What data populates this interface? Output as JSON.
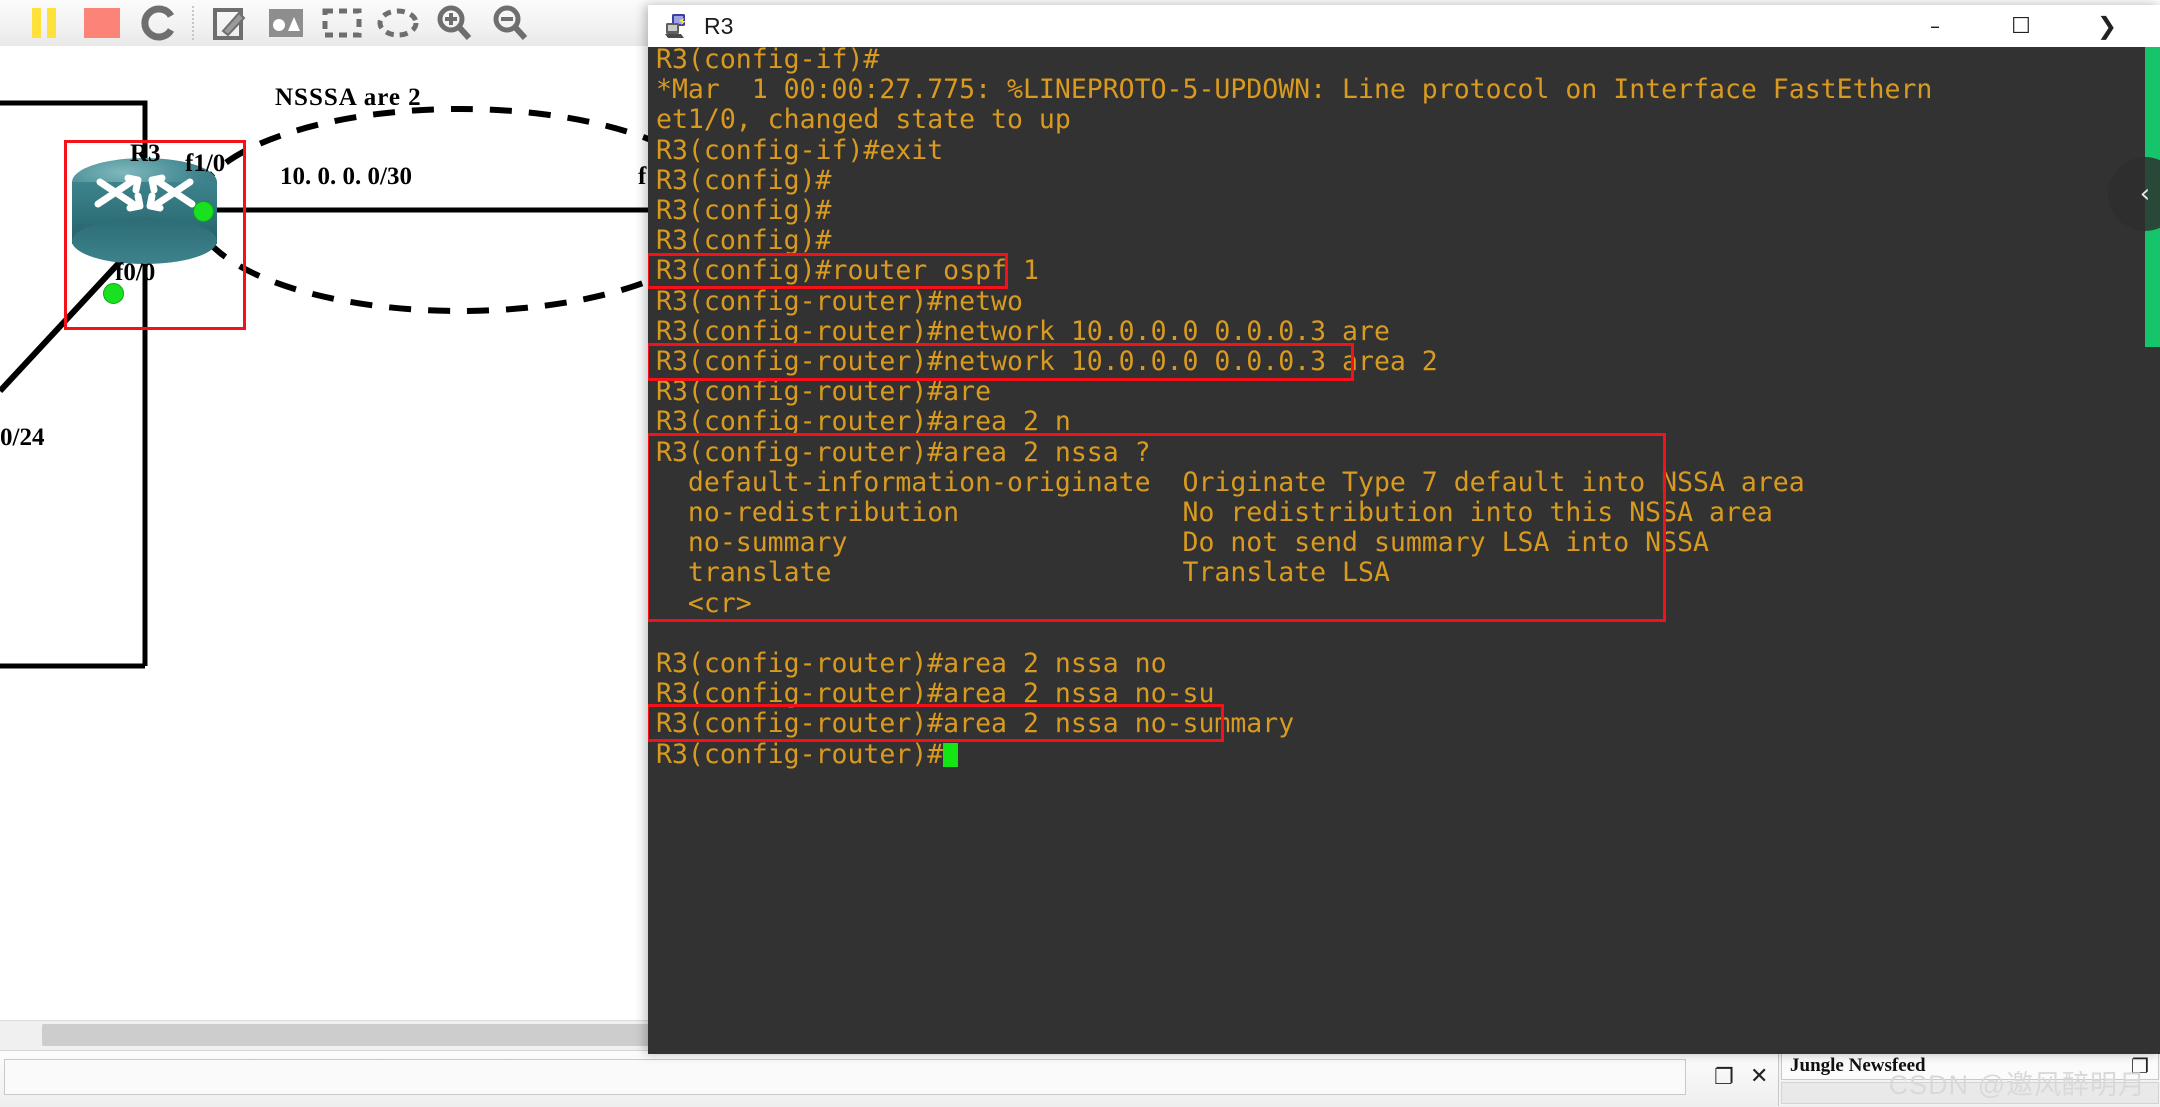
{
  "toolbar": {
    "items": [
      {
        "name": "pause-icon",
        "glyph": "❚❚"
      },
      {
        "name": "stop-icon",
        "glyph": "■"
      },
      {
        "name": "reload-icon",
        "glyph": "C"
      },
      {
        "name": "add-note-icon",
        "glyph": "✎"
      },
      {
        "name": "insert-picture-icon",
        "glyph": "▲"
      },
      {
        "name": "draw-rectangle-icon",
        "glyph": "▭"
      },
      {
        "name": "draw-ellipse-icon",
        "glyph": "◯"
      },
      {
        "name": "zoom-in-icon",
        "glyph": "⊕"
      },
      {
        "name": "zoom-out-icon",
        "glyph": "⊖"
      }
    ]
  },
  "topology": {
    "area_label": "NSSSA  are 2",
    "link_subnet": "10. 0. 0. 0/30",
    "router_name": "R3",
    "iface_top": "f1/0",
    "iface_bottom": "f0/0",
    "left_subnet_partial": "0/24",
    "right_iface_partial": "f"
  },
  "window": {
    "title": "R3",
    "icon": "console-terminal-icon",
    "minimize": "–",
    "maximize": "☐",
    "close": "❯"
  },
  "overlay": {
    "back_chevron": "‹"
  },
  "terminal": {
    "prompt_config_if": "R3(config-if)#",
    "lines": [
      "R3(config-if)#",
      "*Mar  1 00:00:27.775: %LINEPROTO-5-UPDOWN: Line protocol on Interface FastEthern",
      "et1/0, changed state to up",
      "R3(config-if)#exit",
      "R3(config)#",
      "R3(config)#",
      "R3(config)#",
      "R3(config)#router ospf 1",
      "R3(config-router)#netwo",
      "R3(config-router)#network 10.0.0.0 0.0.0.3 are",
      "R3(config-router)#network 10.0.0.0 0.0.0.3 area 2",
      "R3(config-router)#are",
      "R3(config-router)#area 2 n",
      "R3(config-router)#area 2 nssa ?",
      "  default-information-originate  Originate Type 7 default into NSSA area",
      "  no-redistribution              No redistribution into this NSSA area",
      "  no-summary                     Do not send summary LSA into NSSA",
      "  translate                      Translate LSA",
      "  <cr>",
      "",
      "R3(config-router)#area 2 nssa no",
      "R3(config-router)#area 2 nssa no-su",
      "R3(config-router)#area 2 nssa no-summary",
      "R3(config-router)#"
    ],
    "help_options": [
      {
        "keyword": "default-information-originate",
        "description": "Originate Type 7 default into NSSA area"
      },
      {
        "keyword": "no-redistribution",
        "description": "No redistribution into this NSSA area"
      },
      {
        "keyword": "no-summary",
        "description": "Do not send summary LSA into NSSA"
      },
      {
        "keyword": "translate",
        "description": "Translate LSA"
      },
      {
        "keyword": "<cr>",
        "description": ""
      }
    ],
    "highlighted_commands": [
      "R3(config)#router ospf 1",
      "R3(config-router)#network 10.0.0.0 0.0.0.3 area 2",
      "R3(config-router)#area 2 nssa ?",
      "R3(config-router)#area 2 nssa no-summary"
    ],
    "colors": {
      "background": "#323232",
      "text": "#d99a20",
      "cursor": "#14e614",
      "highlight": "#f5111a"
    }
  },
  "newsfeed": {
    "title": "Jungle Newsfeed",
    "float_icon": "❐",
    "close_icon": "✕",
    "dock_icon": "❐"
  },
  "watermark": {
    "text": "CSDN @邀风醉明月"
  }
}
